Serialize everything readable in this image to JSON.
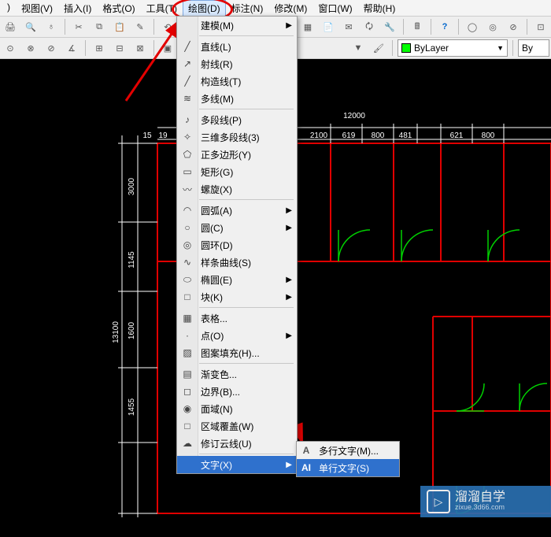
{
  "menubar": {
    "items": [
      {
        "label": ")"
      },
      {
        "label": "视图(V)"
      },
      {
        "label": "插入(I)"
      },
      {
        "label": "格式(O)"
      },
      {
        "label": "工具(T)"
      },
      {
        "label": "绘图(D)",
        "active": true
      },
      {
        "label": "标注(N)"
      },
      {
        "label": "修改(M)"
      },
      {
        "label": "窗口(W)"
      },
      {
        "label": "帮助(H)"
      }
    ]
  },
  "toolbar": {
    "layer_text": "ByLayer",
    "layer_text2": "By"
  },
  "draw_menu": {
    "top": {
      "label": "建模(M)",
      "has_sub": true
    },
    "g1": [
      {
        "ico": "╱",
        "label": "直线(L)"
      },
      {
        "ico": "↗",
        "label": "射线(R)"
      },
      {
        "ico": "╱",
        "label": "构造线(T)"
      },
      {
        "ico": "≋",
        "label": "多线(M)"
      }
    ],
    "g2": [
      {
        "ico": "♪",
        "label": "多段线(P)"
      },
      {
        "ico": "✧",
        "label": "三维多段线(3)"
      },
      {
        "ico": "⬠",
        "label": "正多边形(Y)"
      },
      {
        "ico": "▭",
        "label": "矩形(G)"
      },
      {
        "ico": "〰",
        "label": "螺旋(X)"
      }
    ],
    "g3": [
      {
        "ico": "◠",
        "label": "圆弧(A)",
        "sub": true
      },
      {
        "ico": "○",
        "label": "圆(C)",
        "sub": true
      },
      {
        "ico": "◎",
        "label": "圆环(D)"
      },
      {
        "ico": "∿",
        "label": "样条曲线(S)"
      },
      {
        "ico": "⬭",
        "label": "椭圆(E)",
        "sub": true
      },
      {
        "ico": "□",
        "label": "块(K)",
        "sub": true
      }
    ],
    "g4": [
      {
        "ico": "▦",
        "label": "表格..."
      },
      {
        "ico": "·",
        "label": "点(O)",
        "sub": true
      },
      {
        "ico": "▨",
        "label": "图案填充(H)..."
      }
    ],
    "g5": [
      {
        "ico": "▤",
        "label": "渐变色..."
      },
      {
        "ico": "◻",
        "label": "边界(B)..."
      },
      {
        "ico": "◉",
        "label": "面域(N)"
      },
      {
        "ico": "□",
        "label": "区域覆盖(W)"
      },
      {
        "ico": "☁",
        "label": "修订云线(U)"
      }
    ],
    "g6": [
      {
        "ico": "",
        "label": "文字(X)",
        "sub": true,
        "highlight": true
      }
    ]
  },
  "submenu": {
    "items": [
      {
        "ico": "A",
        "label": "多行文字(M)..."
      },
      {
        "ico": "AI",
        "label": "单行文字(S)",
        "highlight": true
      }
    ]
  },
  "dims": {
    "d1": "3000",
    "d2": "1145",
    "d3": "1600",
    "d4": "1455",
    "d_all": "13100",
    "top_total": "12000",
    "t1": "2100",
    "t2": "619",
    "t3": "800",
    "t4": "481",
    "t5": "621",
    "t6": "800",
    "v1": "15",
    "v2": "19"
  },
  "wm": {
    "name": "溜溜自学",
    "url": "zixue.3d66.com"
  }
}
